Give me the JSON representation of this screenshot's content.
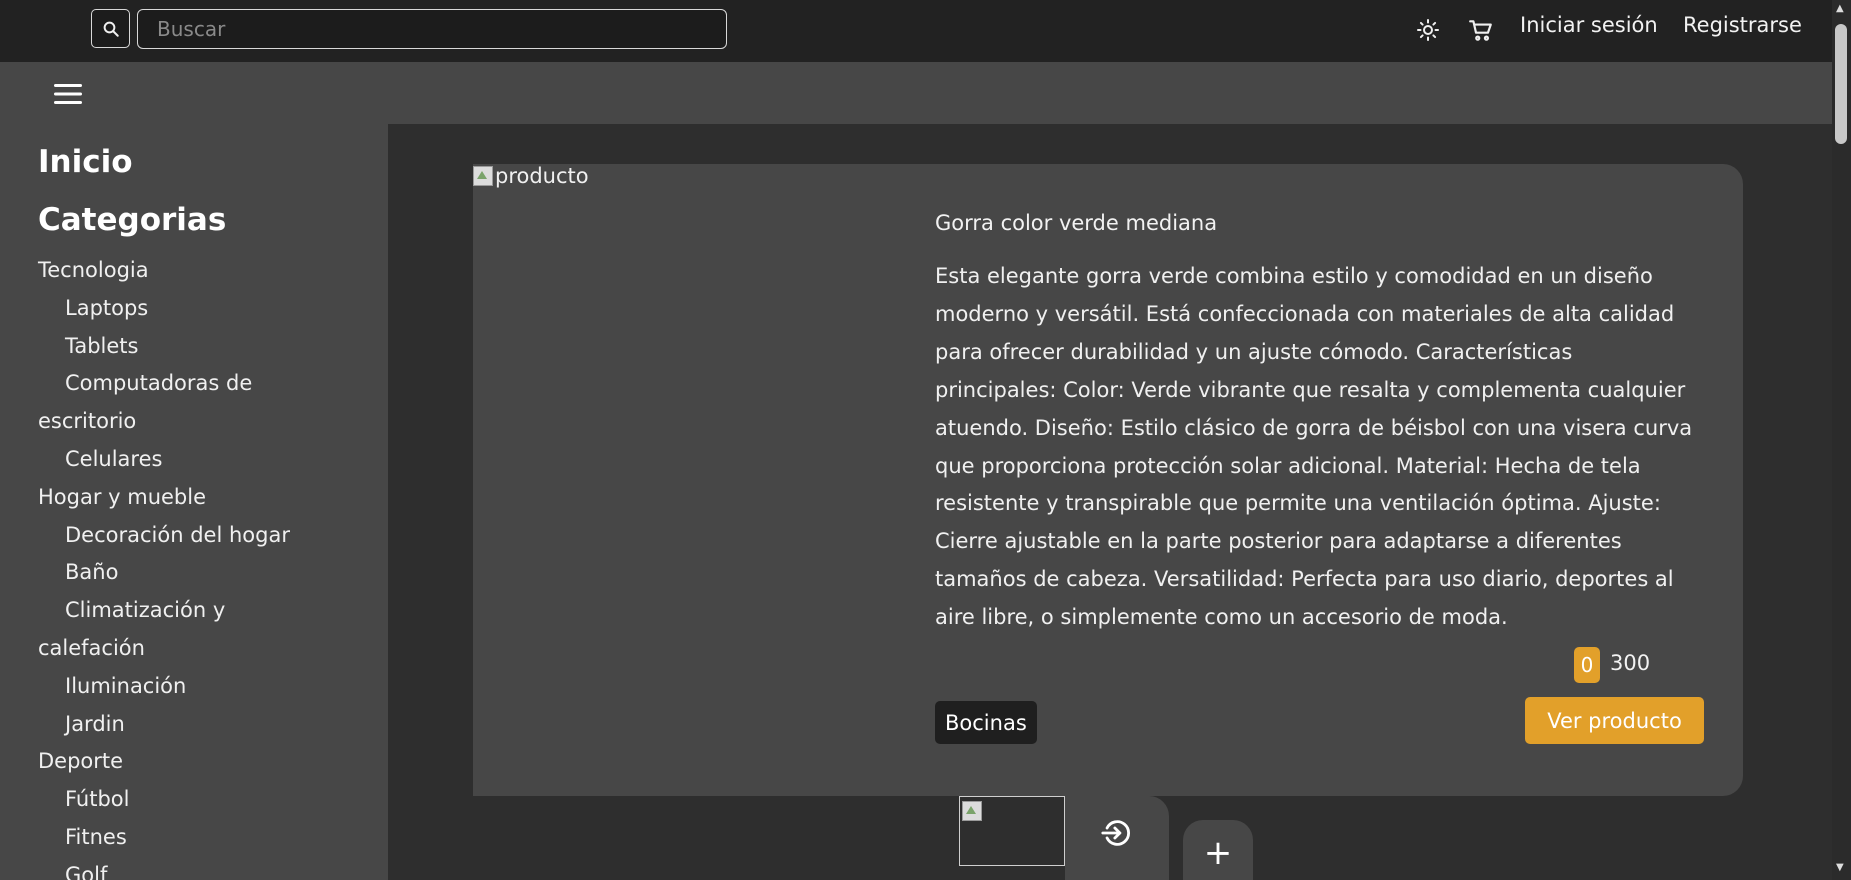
{
  "header": {
    "search_placeholder": "Buscar",
    "search_icon": "search-icon",
    "theme_icon": "sun-icon",
    "cart_icon": "cart-icon",
    "login_label": "Iniciar sesión",
    "register_label": "Registrarse"
  },
  "sidebar": {
    "menu_icon": "hamburger-icon",
    "home_label": "Inicio",
    "categories_label": "Categorias",
    "categories": [
      {
        "name": "Tecnologia",
        "subs": [
          "Laptops",
          "Tablets",
          "Computadoras de escritorio",
          "Celulares"
        ]
      },
      {
        "name": "Hogar y mueble",
        "subs": [
          "Decoración del hogar",
          "Baño",
          "Climatización y calefación",
          "Iluminación",
          "Jardin"
        ]
      },
      {
        "name": "Deporte",
        "subs": [
          "Fútbol",
          "Fitnes",
          "Golf"
        ]
      }
    ]
  },
  "product": {
    "image_alt": "producto",
    "name": "Gorra color verde mediana",
    "description": "Esta elegante gorra verde combina estilo y comodidad en un diseño moderno y versátil. Está confeccionada con materiales de alta calidad para ofrecer durabilidad y un ajuste cómodo. Características principales: Color: Verde vibrante que resalta y complementa cualquier atuendo. Diseño: Estilo clásico de gorra de béisbol con una visera curva que proporciona protección solar adicional. Material: Hecha de tela resistente y transpirable que permite una ventilación óptima. Ajuste: Cierre ajustable en la parte posterior para adaptarse a diferentes tamaños de cabeza. Versatilidad: Perfecta para uso diario, deportes al aire libre, o simplemente como un accesorio de moda.",
    "quantity": "0",
    "price": "300",
    "tag": "Bocinas",
    "view_label": "Ver producto"
  },
  "fabs": {
    "login_icon": "login-icon",
    "add_icon": "plus-icon",
    "add_label": "+"
  },
  "colors": {
    "accent": "#e2a02a",
    "topbar": "#222222",
    "panel": "#474747",
    "background": "#2e2e2e"
  }
}
